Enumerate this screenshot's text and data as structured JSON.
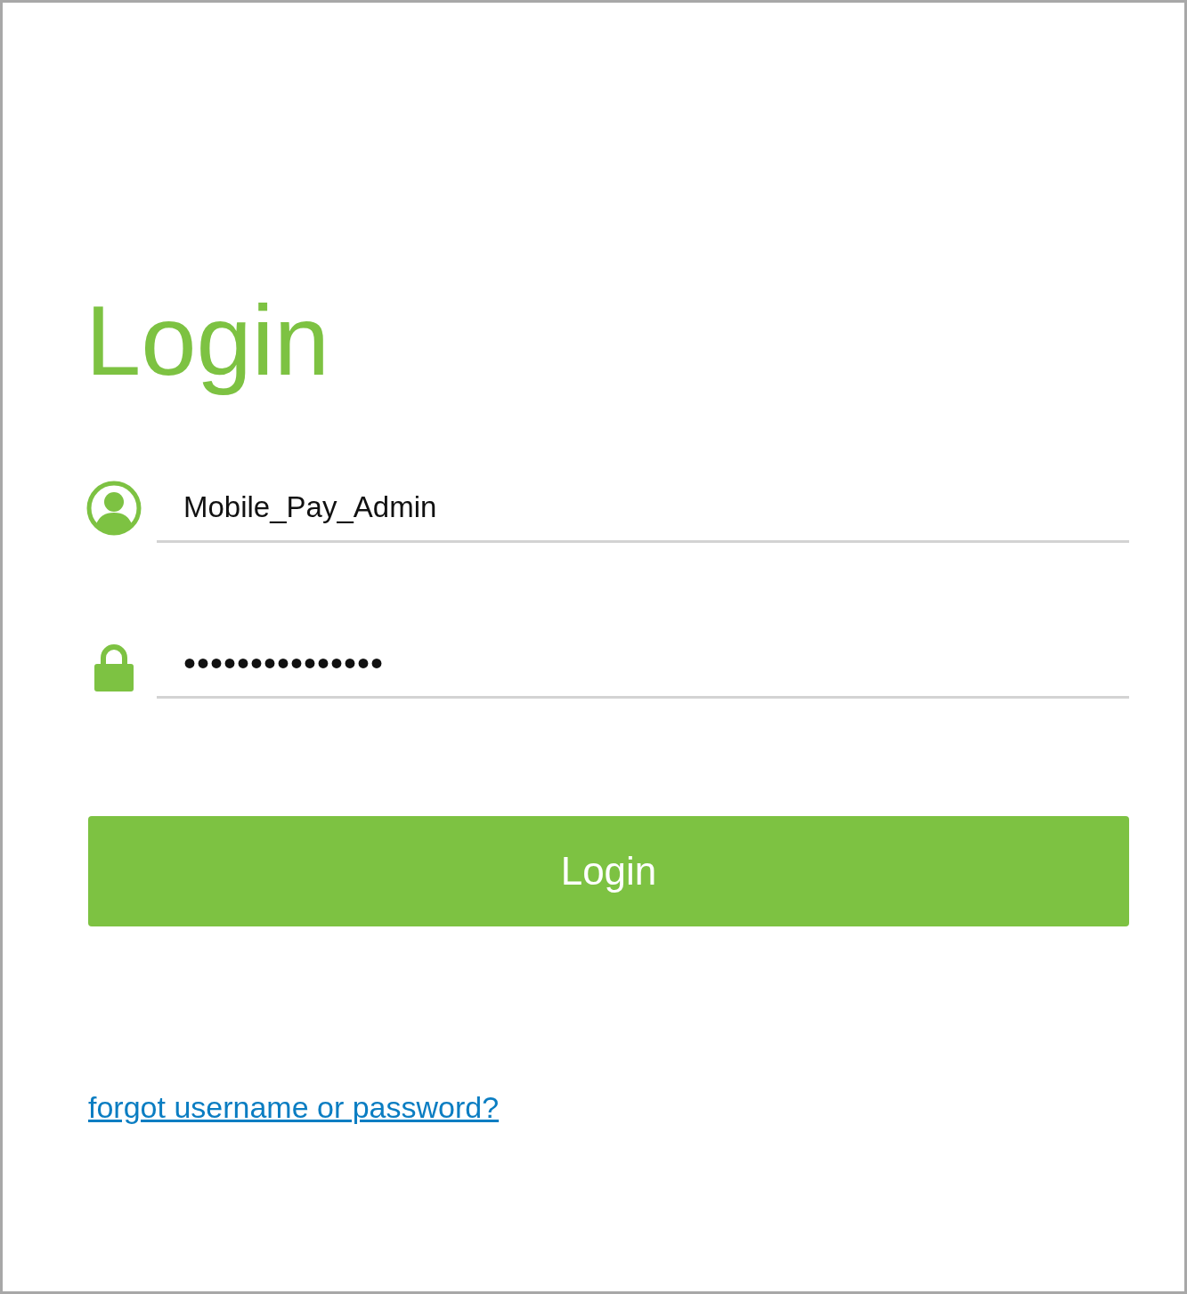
{
  "title": "Login",
  "username": {
    "value": "Mobile_Pay_Admin"
  },
  "password": {
    "value": "•••••••••••••••"
  },
  "login_button": "Login",
  "forgot_link": "forgot username or password?"
}
